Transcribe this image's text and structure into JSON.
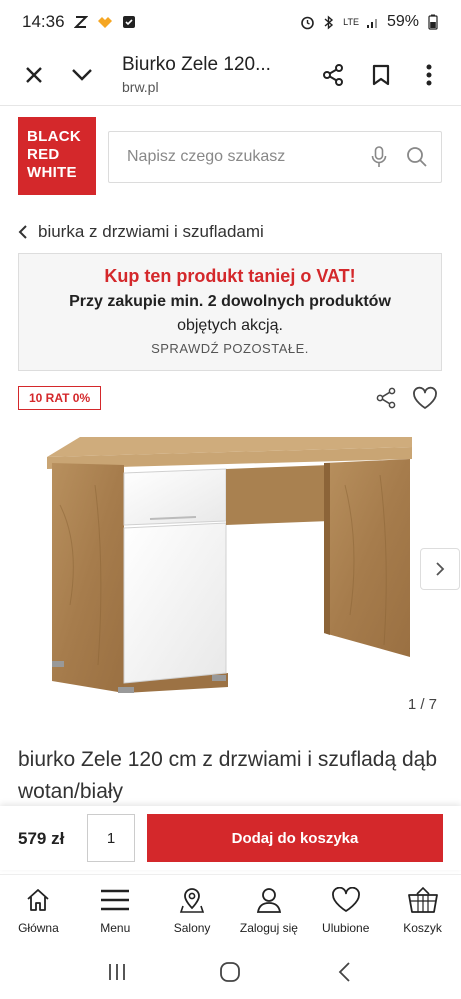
{
  "status_bar": {
    "time": "14:36",
    "battery": "59%",
    "network": "LTE"
  },
  "browser": {
    "title": "Biurko Zele 120...",
    "url": "brw.pl"
  },
  "logo": {
    "line1": "BLACK",
    "line2": "RED",
    "line3": "WHITE"
  },
  "search": {
    "placeholder": "Napisz czego szukasz"
  },
  "breadcrumb": {
    "label": "biurka z drzwiami i szufladami"
  },
  "promo": {
    "title": "Kup ten produkt taniej o VAT!",
    "line1": "Przy zakupie min. 2 dowolnych produktów",
    "line2": "objętych akcją.",
    "link": "SPRAWDŹ POZOSTAŁE."
  },
  "badge": {
    "raty": "10 RAT 0%"
  },
  "gallery": {
    "counter": "1 / 7"
  },
  "product": {
    "title": "biurko Zele 120 cm z drzwiami i szufladą dąb wotan/biały"
  },
  "purchase": {
    "price": "579 zł",
    "quantity": "1",
    "add_to_cart": "Dodaj do koszyka"
  },
  "bottom_nav": {
    "items": [
      {
        "label": "Główna",
        "icon": "home-icon"
      },
      {
        "label": "Menu",
        "icon": "menu-icon"
      },
      {
        "label": "Salony",
        "icon": "location-icon"
      },
      {
        "label": "Zaloguj się",
        "icon": "user-icon"
      },
      {
        "label": "Ulubione",
        "icon": "heart-icon"
      },
      {
        "label": "Koszyk",
        "icon": "cart-icon"
      }
    ]
  },
  "colors": {
    "brand_red": "#d4282b",
    "text": "#222222",
    "promo_bg": "#f6f6f6"
  }
}
